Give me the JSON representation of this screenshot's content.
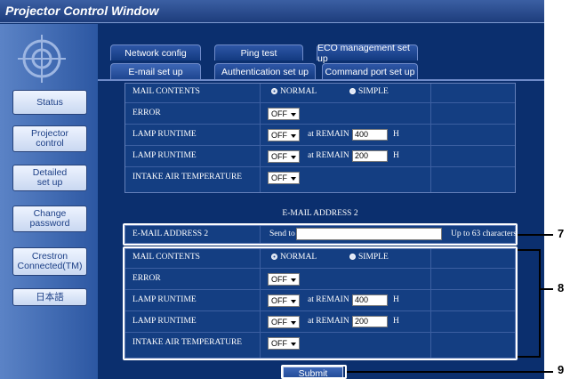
{
  "window_title": "Projector Control Window",
  "sidebar": {
    "buttons": [
      {
        "label": "Status"
      },
      {
        "label": "Projector\ncontrol"
      },
      {
        "label": "Detailed\nset up"
      },
      {
        "label": "Change\npassword"
      },
      {
        "label": "Crestron\nConnected(TM)"
      },
      {
        "label": "日本語"
      }
    ]
  },
  "tabs": {
    "row1": [
      "Network config",
      "Ping test",
      "ECO management set up"
    ],
    "row2": [
      "E-mail set up",
      "Authentication set up",
      "Command port set up"
    ]
  },
  "section1": {
    "mail_contents_label": "MAIL CONTENTS",
    "normal_label": "NORMAL",
    "simple_label": "SIMPLE",
    "error_label": "ERROR",
    "error_value": "OFF",
    "lamp1_label": "LAMP RUNTIME",
    "lamp1_value": "OFF",
    "lamp1_remain": "at REMAIN",
    "lamp1_hours": "400",
    "lamp1_unit": "H",
    "lamp2_label": "LAMP RUNTIME",
    "lamp2_value": "OFF",
    "lamp2_remain": "at REMAIN",
    "lamp2_hours": "200",
    "lamp2_unit": "H",
    "intake_label": "INTAKE AIR TEMPERATURE",
    "intake_value": "OFF"
  },
  "address2": {
    "heading": "E-MAIL ADDRESS 2",
    "label": "E-MAIL ADDRESS 2",
    "send_to": "Send to",
    "value": "",
    "limit": "Up to 63 characters"
  },
  "section2": {
    "mail_contents_label": "MAIL CONTENTS",
    "normal_label": "NORMAL",
    "simple_label": "SIMPLE",
    "error_label": "ERROR",
    "error_value": "OFF",
    "lamp1_label": "LAMP RUNTIME",
    "lamp1_value": "OFF",
    "lamp1_remain": "at REMAIN",
    "lamp1_hours": "400",
    "lamp1_unit": "H",
    "lamp2_label": "LAMP RUNTIME",
    "lamp2_value": "OFF",
    "lamp2_remain": "at REMAIN",
    "lamp2_hours": "200",
    "lamp2_unit": "H",
    "intake_label": "INTAKE AIR TEMPERATURE",
    "intake_value": "OFF"
  },
  "submit_label": "Submit",
  "callouts": [
    "7",
    "8",
    "9"
  ]
}
